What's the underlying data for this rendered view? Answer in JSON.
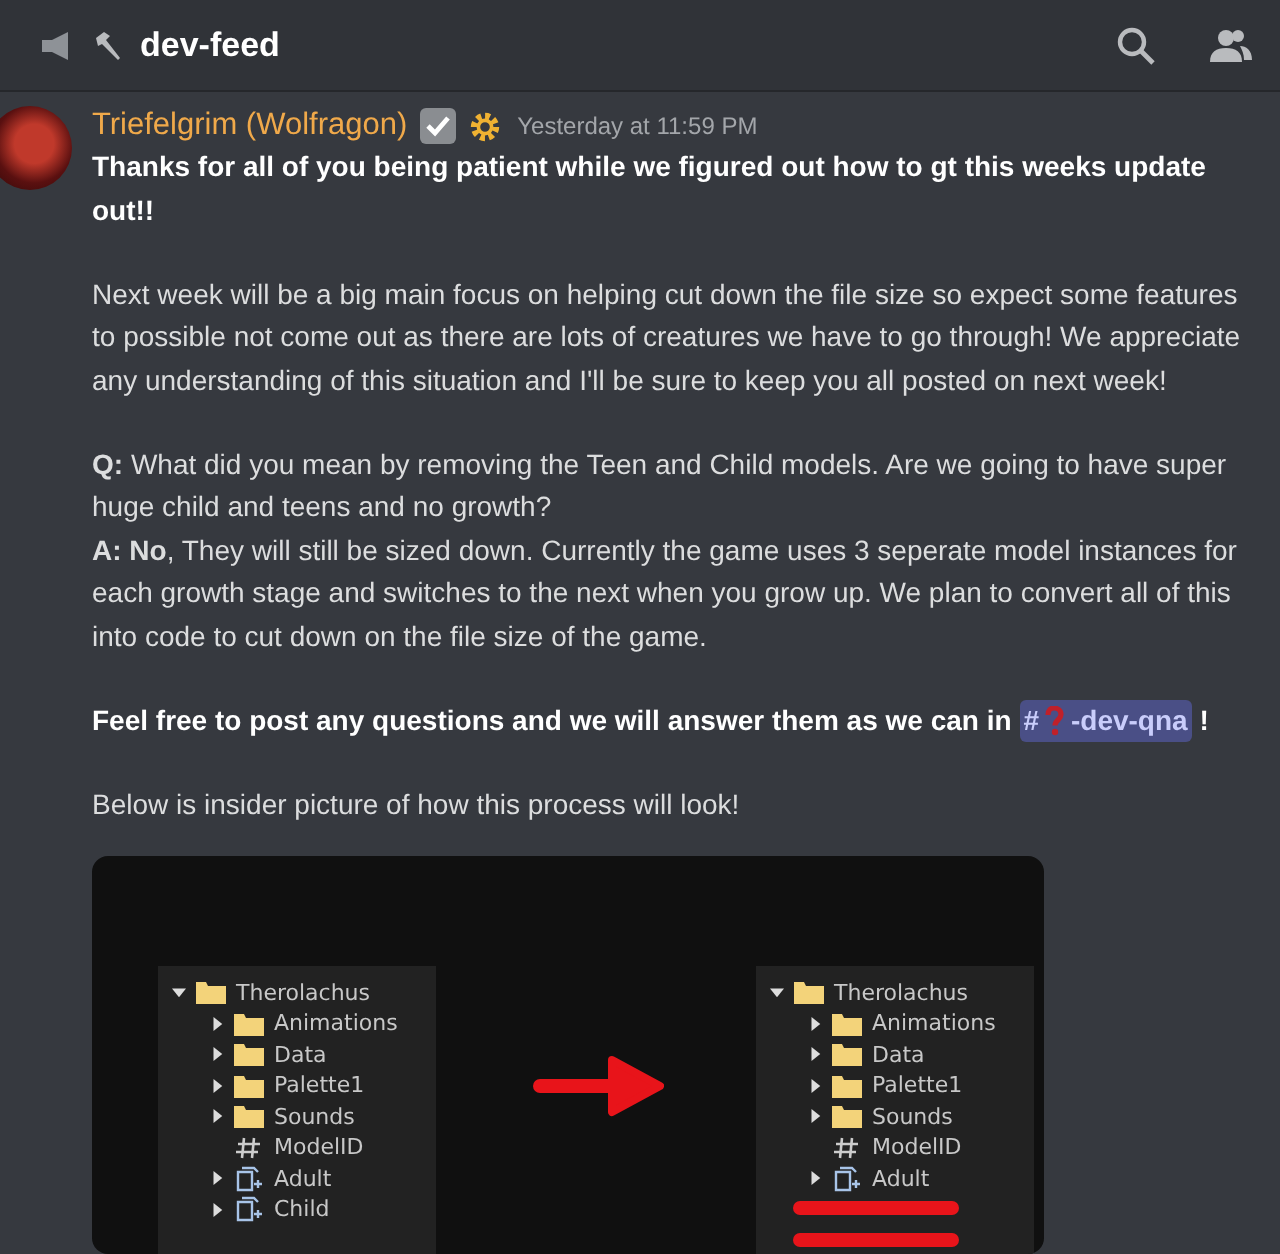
{
  "channel": {
    "name": "dev-feed"
  },
  "message": {
    "author": "Triefelgrim (Wolfragon)",
    "timestamp": "Yesterday at 11:59 PM",
    "paragraphs": [
      {
        "kind": "bold",
        "text": "Thanks for all of you being patient while we figured out how to gt this weeks update out!!"
      },
      {
        "kind": "plain",
        "text": "Next week will be a big main focus on helping cut down the file size so expect some features to possible not come out as there are lots of creatures we have to go through! We appreciate any understanding of this situation and I'll be sure to keep you all posted on next week!"
      },
      {
        "kind": "qa",
        "lines": [
          "**Q:** What did you mean by removing the Teen and Child models. Are we going to have super huge child and teens and no growth?",
          "**A:  No**, They will still be sized down. Currently the game uses 3 seperate model instances for each growth stage and switches to the next when you grow up. We plan to convert all of this into code to cut down on the file size of the game."
        ]
      },
      {
        "kind": "mention",
        "before": "Feel free to post any questions and we will answer them as we can in",
        "hash": "#",
        "channel": "-dev-qna",
        "after": "!"
      },
      {
        "kind": "plain",
        "text": "Below is insider picture of how this process will look!"
      }
    ],
    "attachment": {
      "panels": [
        {
          "name": "Therolachus",
          "expanded": true,
          "children": [
            {
              "kind": "folder",
              "name": "Animations",
              "expanded": false
            },
            {
              "kind": "folder",
              "name": "Data",
              "expanded": false
            },
            {
              "kind": "folder",
              "name": "Palette1",
              "expanded": false
            },
            {
              "kind": "folder",
              "name": "Sounds",
              "expanded": false
            },
            {
              "kind": "field",
              "name": "ModelID"
            },
            {
              "kind": "model",
              "name": "Adult",
              "expanded": false
            },
            {
              "kind": "model",
              "name": "Child",
              "expanded": false
            }
          ]
        },
        {
          "name": "Therolachus",
          "expanded": true,
          "children": [
            {
              "kind": "folder",
              "name": "Animations",
              "expanded": false
            },
            {
              "kind": "folder",
              "name": "Data",
              "expanded": false
            },
            {
              "kind": "folder",
              "name": "Palette1",
              "expanded": false
            },
            {
              "kind": "folder",
              "name": "Sounds",
              "expanded": false
            },
            {
              "kind": "field",
              "name": "ModelID"
            },
            {
              "kind": "model",
              "name": "Adult",
              "expanded": false
            },
            {
              "kind": "struck"
            },
            {
              "kind": "struck"
            }
          ]
        }
      ]
    }
  }
}
